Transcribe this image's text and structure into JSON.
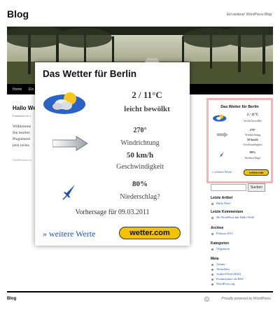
{
  "site": {
    "title": "Blog",
    "description": "Ein weiterer WordPress-Blog"
  },
  "nav": {
    "items": [
      "Home",
      "Ein"
    ]
  },
  "post": {
    "title": "Hallo We",
    "meta": "Published on J",
    "body_lines": [
      "Willkomme",
      "Ihn bearbei",
      "Pluginberei",
      "jetzt nichts"
    ],
    "footer": "Veröffentlicht in"
  },
  "popup": {
    "title": "Das Wetter für Berlin",
    "temp": "2 / 11°C",
    "condition": "leicht bewölkt",
    "wind_direction": "270°",
    "wind_direction_label": "Windrichtung",
    "wind_speed": "50 km/h",
    "wind_speed_label": "Geschwindigkeit",
    "precip": "80%",
    "precip_label": "Niederschlag?",
    "forecast": "Vorhersage für 09.03.2011",
    "more_link": "» weitere Werte",
    "logo": "wetter.com",
    "icons": {
      "weather": "partly-cloudy-icon",
      "wind": "wind-arrow-icon",
      "umbrella": "umbrella-icon"
    }
  },
  "widget": {
    "title": "Das Wetter für Berlin",
    "temp": "2 / 11°C",
    "condition": "leicht bewölkt",
    "wind_direction": "270°",
    "wind_direction_label": "Windrichtung",
    "wind_speed": "50 km/h",
    "wind_speed_label": "Geschwindigkeit",
    "precip": "80%",
    "precip_label": "Niederschlag?",
    "more_link": "» weitere Werte",
    "logo": "wetter.com",
    "border_color": "#f0b5b5"
  },
  "sidebar": {
    "search_button": "Suchen",
    "recent_posts_title": "Letzte Artikel",
    "recent_posts": [
      "Hallo Welt!"
    ],
    "recent_comments_title": "Letzte Kommentare",
    "recent_comment_author": "Mr WordPress",
    "recent_comment_on": "bei",
    "recent_comment_post": "Hallo Welt!",
    "archive_title": "Archive",
    "archive": [
      "Februar 2011"
    ],
    "categories_title": "Kategorien",
    "categories": [
      "Allgemein"
    ],
    "meta_title": "Meta",
    "meta": [
      "Admin",
      "Abmelden",
      "Artikel-Feed (RSS)",
      "Kommentare als RSS",
      "WordPress.org"
    ]
  },
  "footer": {
    "left": "Blog",
    "right": "Proudly powered by WordPress."
  },
  "colors": {
    "accent_link": "#1a57c6",
    "logo_yellow": "#f2c200",
    "widget_border": "#f0b5b5"
  }
}
